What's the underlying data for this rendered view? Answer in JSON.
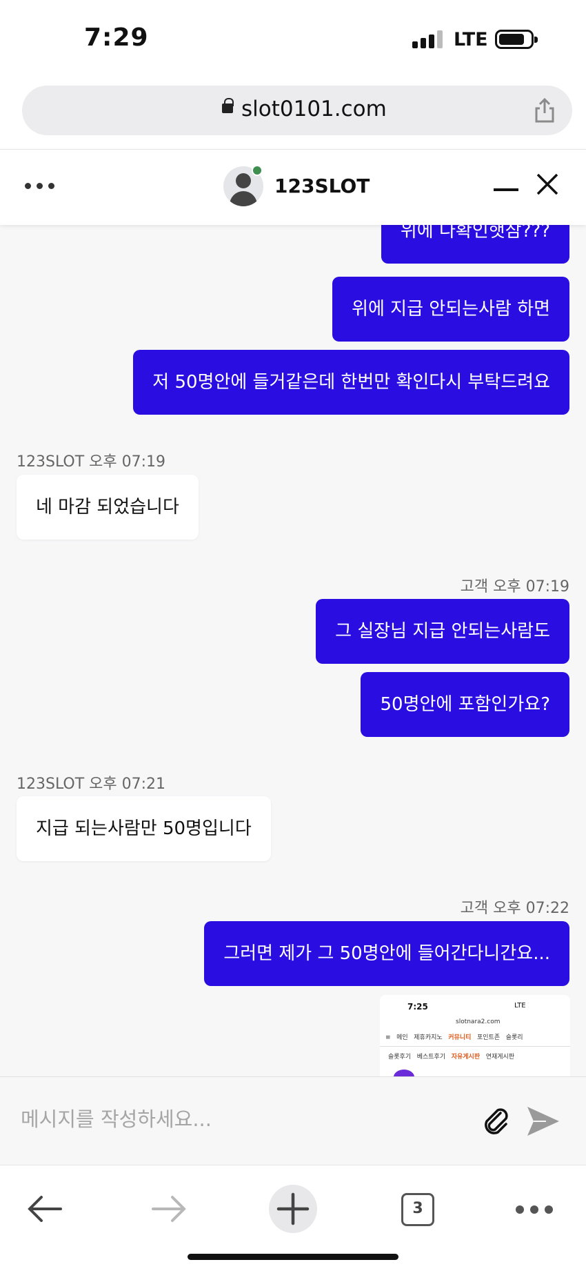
{
  "status_bar": {
    "time": "7:29",
    "network": "LTE"
  },
  "browser": {
    "url": "slot0101.com",
    "tab_count": "3"
  },
  "chat": {
    "title": "123SLOT",
    "online_color": "#3d8e4f",
    "outgoing_color": "#2a0de0",
    "input_placeholder": "메시지를 작성하세요...",
    "messages": [
      {
        "dir": "out",
        "text": "위에 다확인햇삼???"
      },
      {
        "dir": "out",
        "text": "위에 지급 안되는사람 하면"
      },
      {
        "dir": "out",
        "text": "저 50명안에 들거같은데 한번만 확인다시 부탁드려요"
      },
      {
        "dir": "in",
        "meta": "123SLOT 오후 07:19",
        "text": "네 마감 되었습니다"
      },
      {
        "dir": "out",
        "meta": "고객 오후 07:19",
        "text": "그 실장님 지급 안되는사람도"
      },
      {
        "dir": "out",
        "text": "50명안에 포함인가요?"
      },
      {
        "dir": "in",
        "meta": "123SLOT 오후 07:21",
        "text": "지급 되는사람만 50명입니다"
      },
      {
        "dir": "out",
        "meta": "고객 오후 07:22",
        "text": "그러면 제가 그 50명안에 들어간다니간요..."
      }
    ],
    "attachment_preview": {
      "time": "7:25",
      "network": "LTE",
      "url": "slotnara2.com",
      "nav": [
        "메인",
        "제휴카지노",
        "커뮤니티",
        "포인트존",
        "슬롯리"
      ],
      "sub_nav": [
        "슬롯후기",
        "베스트후기",
        "자유게시판",
        "연재게시판"
      ]
    }
  }
}
